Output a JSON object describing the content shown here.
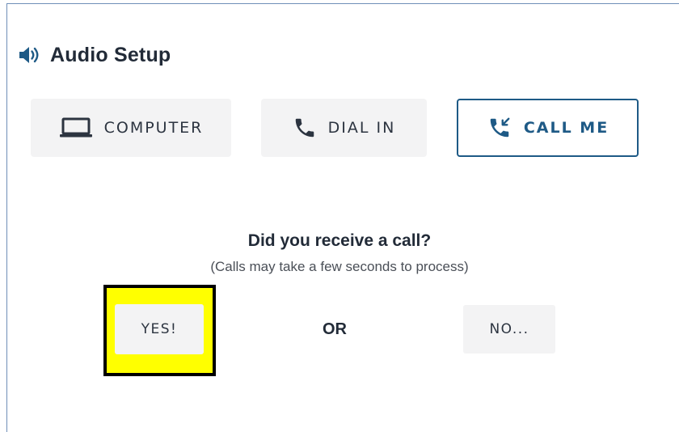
{
  "header": {
    "title": "Audio Setup",
    "icon": "speaker-icon"
  },
  "tabs": [
    {
      "label": "COMPUTER",
      "icon": "laptop-icon",
      "selected": false
    },
    {
      "label": "DIAL IN",
      "icon": "phone-icon",
      "selected": false
    },
    {
      "label": "CALL ME",
      "icon": "phone-incoming-icon",
      "selected": true
    }
  ],
  "prompt": {
    "question": "Did you receive a call?",
    "note": "(Calls may take a few seconds to process)"
  },
  "actions": {
    "yes_label": "YES!",
    "or_label": "OR",
    "no_label": "NO..."
  },
  "colors": {
    "accent": "#1e5a86",
    "highlight": "#ffff00",
    "button_bg": "#f3f3f4",
    "text": "#222b38"
  }
}
